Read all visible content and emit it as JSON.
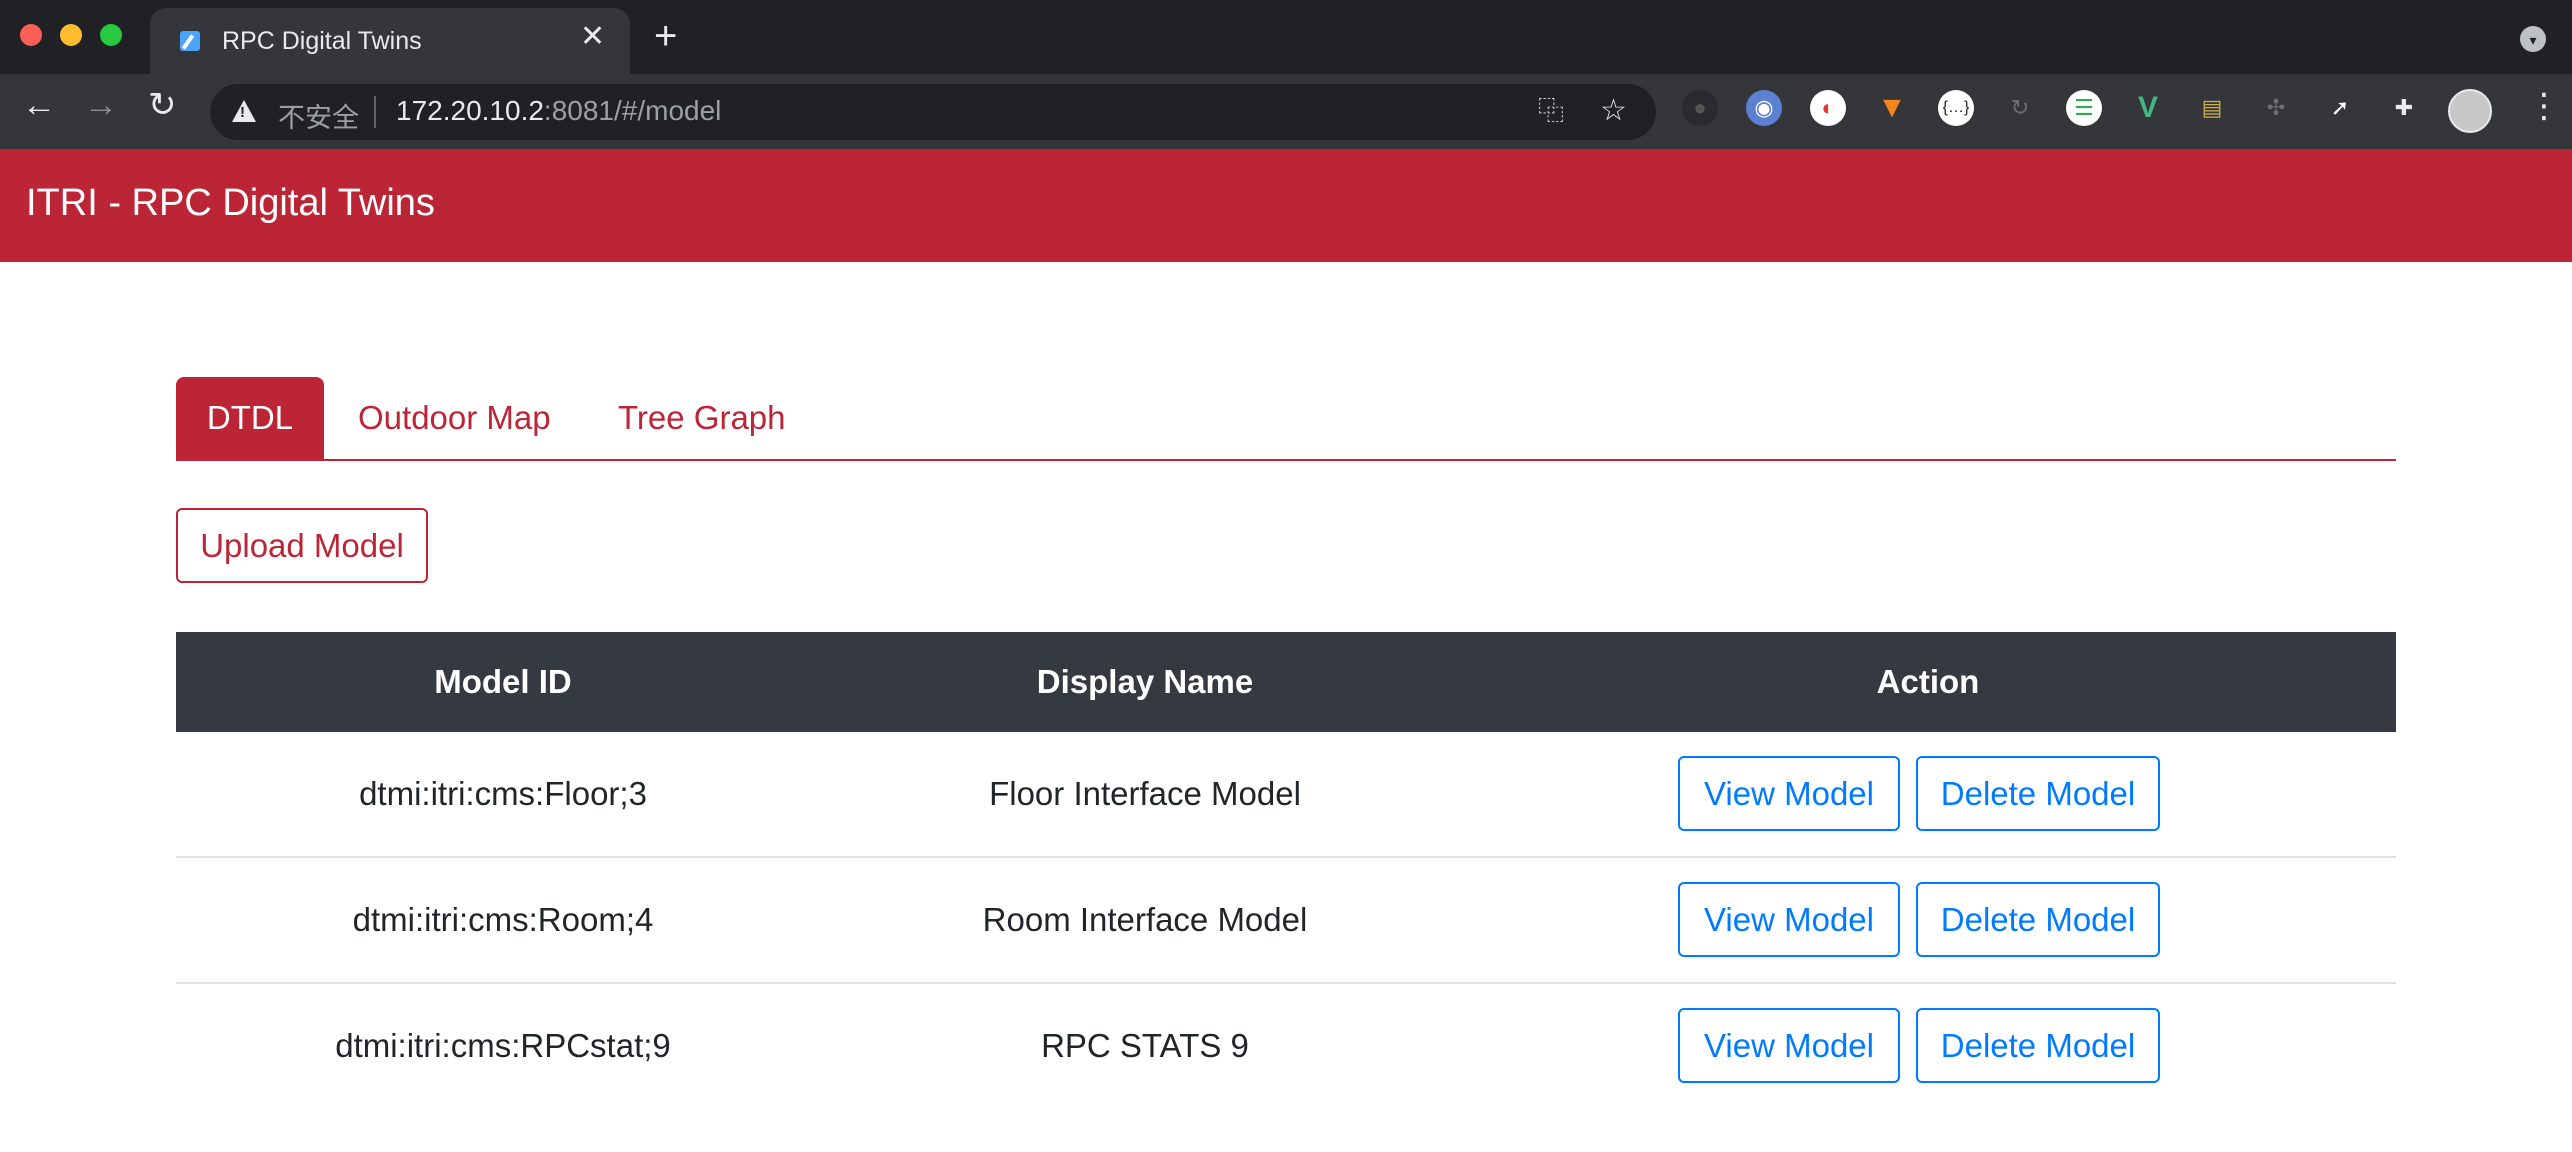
{
  "browser": {
    "tab_title": "RPC Digital Twins",
    "tab_close": "✕",
    "new_tab": "+",
    "omnibox": {
      "security_label": "不安全",
      "url_host": "172.20.10.2",
      "url_rest": ":8081/#/model"
    },
    "nav": {
      "back": "←",
      "forward": "→",
      "reload": "↻"
    },
    "icons": {
      "translate": "translate-icon",
      "bookmark": "star-icon",
      "extensions": [
        "extension-dark-icon",
        "extension-blue-icon",
        "extension-color-icon",
        "metamask-fox-icon",
        "extension-braces-icon",
        "extension-refresh-icon",
        "extension-doc-icon",
        "vue-devtools-icon",
        "extension-image-icon",
        "extension-cross-icon",
        "cursor-icon",
        "puzzle-icon"
      ],
      "profile": "profile-avatar-icon",
      "menu": "menu-dots-icon"
    }
  },
  "app": {
    "brand": "ITRI - RPC Digital Twins",
    "accent": "#bc2535"
  },
  "tabs": [
    {
      "label": "DTDL",
      "active": true
    },
    {
      "label": "Outdoor Map",
      "active": false
    },
    {
      "label": "Tree Graph",
      "active": false
    }
  ],
  "upload_label": "Upload Model",
  "table": {
    "headers": [
      "Model ID",
      "Display Name",
      "Action"
    ],
    "rows": [
      {
        "model_id": "dtmi:itri:cms:Floor;3",
        "display_name": "Floor Interface Model",
        "view_label": "View Model",
        "delete_label": "Delete Model"
      },
      {
        "model_id": "dtmi:itri:cms:Room;4",
        "display_name": "Room Interface Model",
        "view_label": "View Model",
        "delete_label": "Delete Model"
      },
      {
        "model_id": "dtmi:itri:cms:RPCstat;9",
        "display_name": "RPC STATS 9",
        "view_label": "View Model",
        "delete_label": "Delete Model"
      }
    ]
  }
}
